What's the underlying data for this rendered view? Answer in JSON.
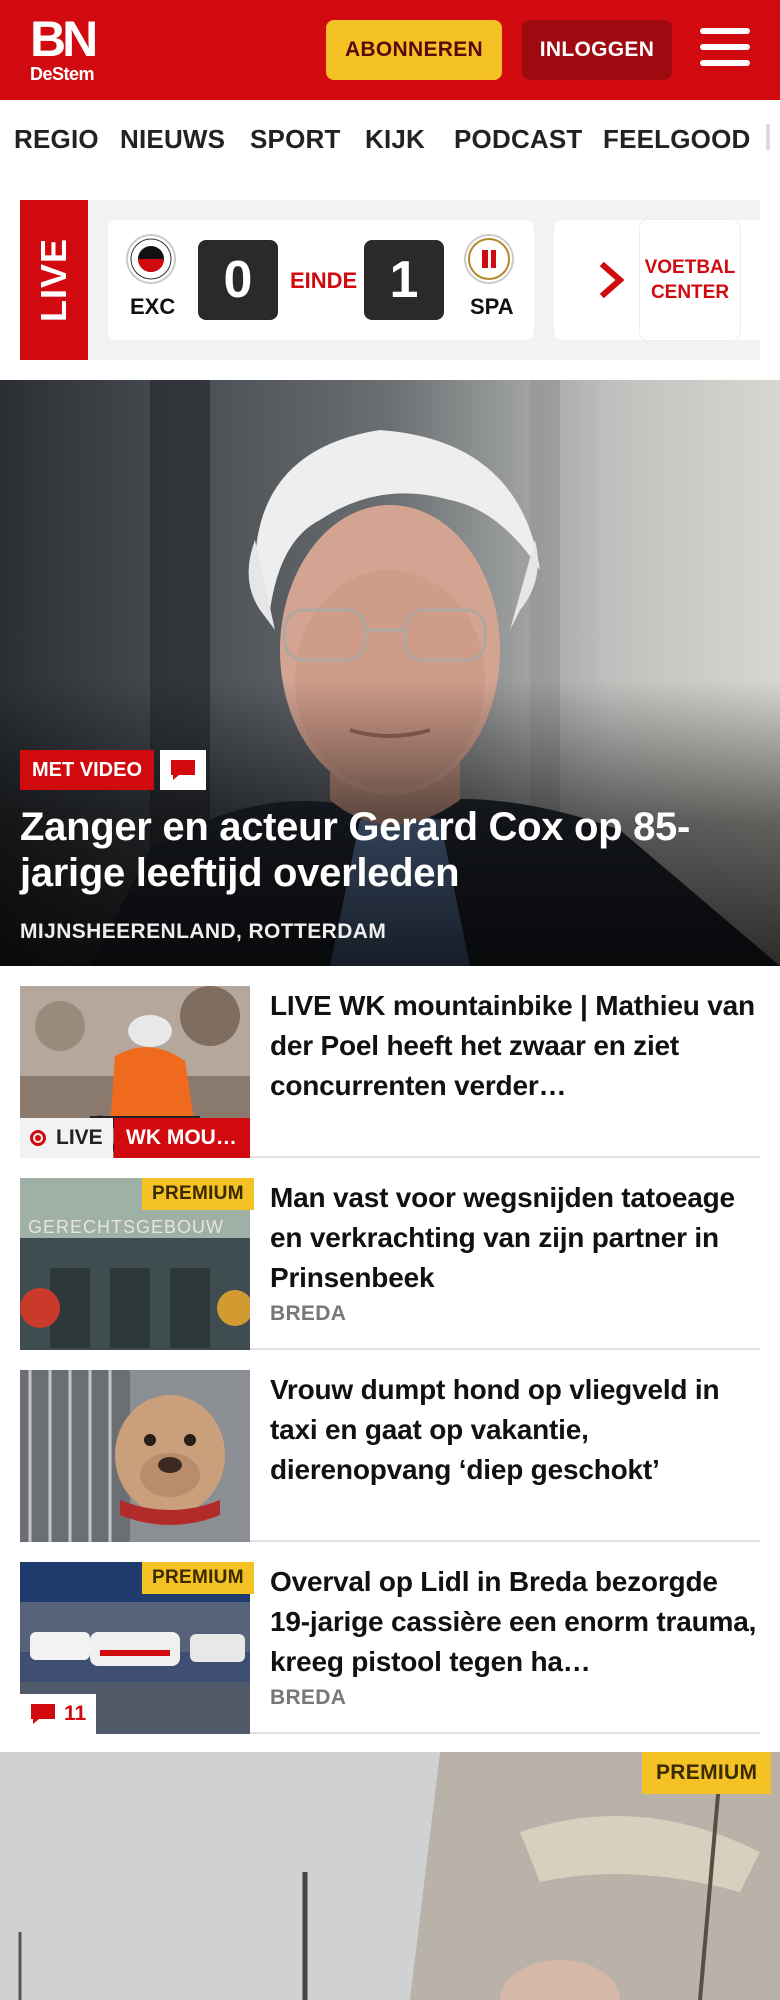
{
  "header": {
    "logo_main": "BN",
    "logo_sub": "DeStem",
    "subscribe_label": "ABONNEREN",
    "login_label": "INLOGGEN"
  },
  "nav": {
    "items": [
      "REGIO",
      "NIEUWS",
      "SPORT",
      "KIJK",
      "PODCAST",
      "FEELGOOD"
    ]
  },
  "live_strip": {
    "live_label": "LIVE",
    "match": {
      "home_abbr": "EXC",
      "home_score": "0",
      "status": "EINDE",
      "away_score": "1",
      "away_abbr": "SPA"
    },
    "voetbal_center_line1": "VOETBAL",
    "voetbal_center_line2": "CENTER"
  },
  "hero": {
    "badge": "MET VIDEO",
    "title": "Zanger en acteur Gerard Cox op 85-jarige leeftijd overleden",
    "location": "MIJNSHEERENLAND, ROTTERDAM"
  },
  "articles": [
    {
      "title": "LIVE WK mountainbike | Mathieu van der Poel heeft het zwaar en ziet concurrenten verder…",
      "live_label": "LIVE",
      "tag": "WK MOU…"
    },
    {
      "title": "Man vast voor wegsnijden tatoeage en verkrachting van zijn partner in Prinsenbeek",
      "premium": "PREMIUM",
      "location": "BREDA",
      "sign_text": "GERECHTSGEBOUW"
    },
    {
      "title": "Vrouw dumpt hond op vliegveld in taxi en gaat op vakantie, dierenopvang ‘diep geschokt’"
    },
    {
      "title": "Overval op Lidl in Breda bezorgde 19-jarige cassière een enorm trauma, kreeg pistool tegen ha…",
      "premium": "PREMIUM",
      "location": "BREDA",
      "comments": "11"
    }
  ],
  "bottom_article": {
    "premium": "PREMIUM"
  },
  "colors": {
    "brand_red": "#d10a10",
    "dark_red": "#9e0a10",
    "premium_yellow": "#f5c225"
  }
}
